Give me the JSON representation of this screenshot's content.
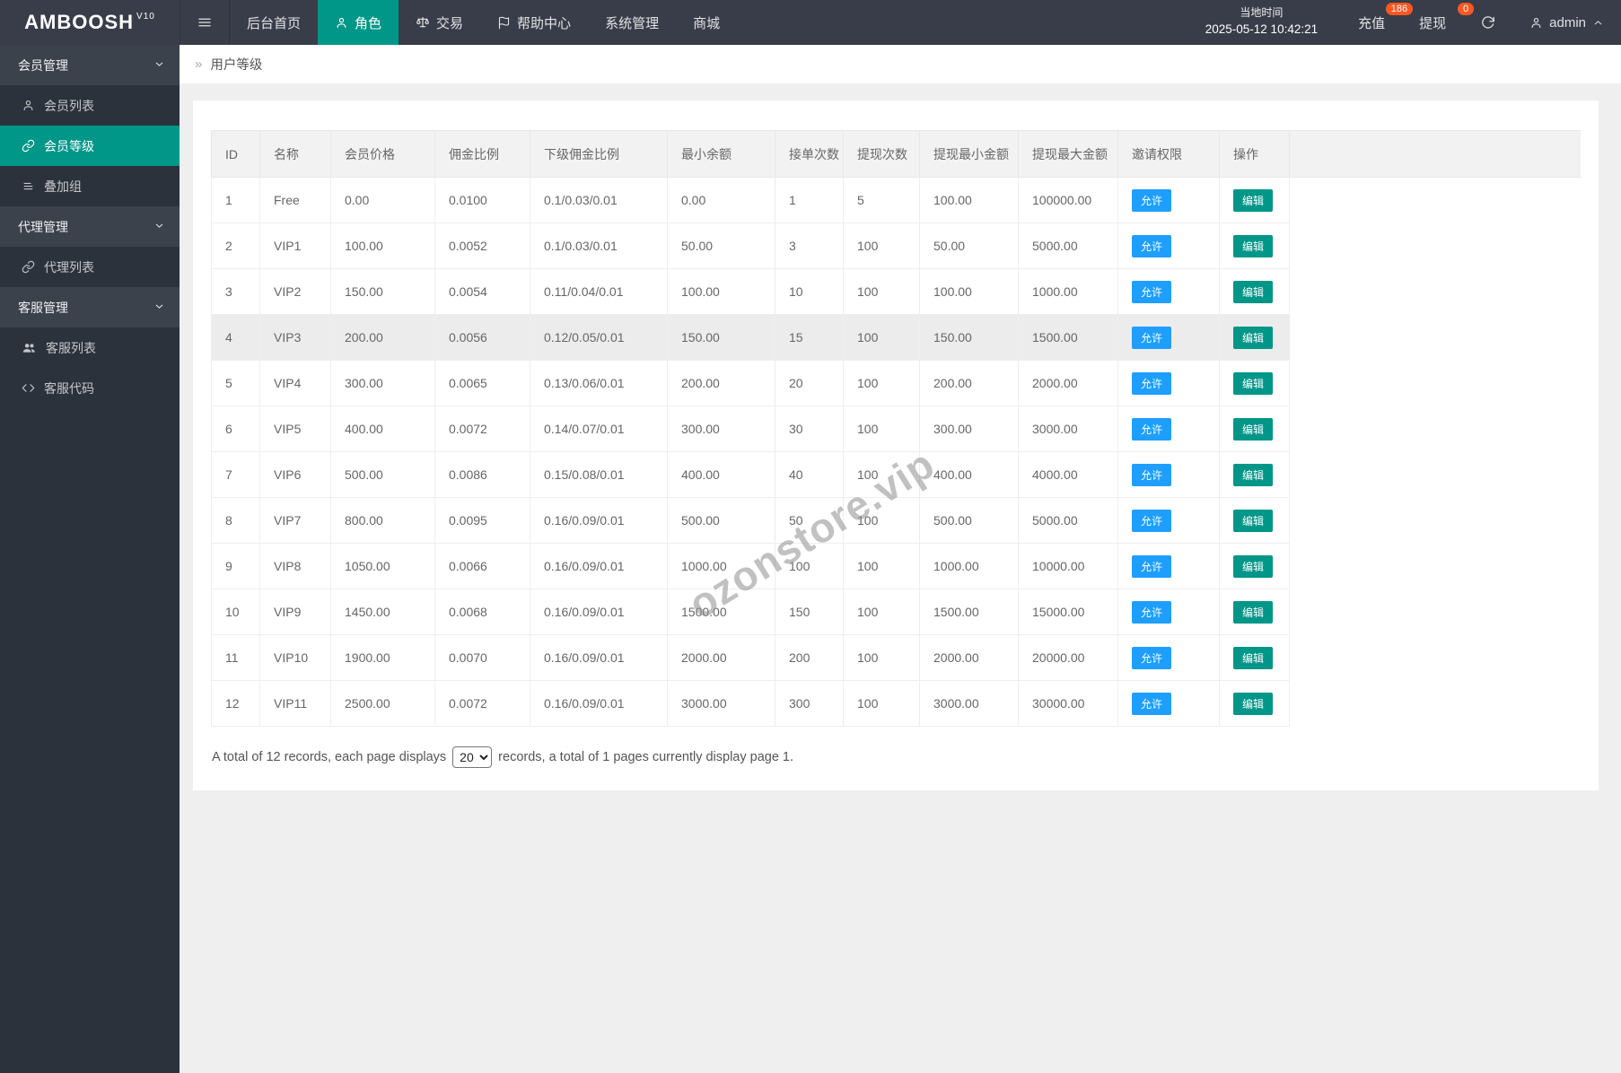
{
  "navbar": {
    "logo": "AMBOOSH",
    "logo_version": "V10",
    "menu": [
      {
        "id": "home",
        "label": "后台首页",
        "icon": "",
        "active": false
      },
      {
        "id": "role",
        "label": "角色",
        "icon": "person",
        "active": true
      },
      {
        "id": "trade",
        "label": "交易",
        "icon": "scale",
        "active": false
      },
      {
        "id": "help",
        "label": "帮助中心",
        "icon": "flag",
        "active": false
      },
      {
        "id": "system",
        "label": "系统管理",
        "icon": "",
        "active": false
      },
      {
        "id": "mall",
        "label": "商城",
        "icon": "",
        "active": false
      }
    ],
    "local_time_label": "当地时间",
    "local_time_value": "2025-05-12 10:42:21",
    "recharge_label": "充值",
    "recharge_badge": "186",
    "withdraw_label": "提现",
    "withdraw_badge": "0",
    "username": "admin"
  },
  "sidebar": {
    "groups": [
      {
        "label": "会员管理",
        "items": [
          {
            "label": "会员列表",
            "icon": "person",
            "active": false
          },
          {
            "label": "会员等级",
            "icon": "link",
            "active": true
          },
          {
            "label": "叠加组",
            "icon": "list",
            "active": false
          }
        ]
      },
      {
        "label": "代理管理",
        "items": [
          {
            "label": "代理列表",
            "icon": "link",
            "active": false
          }
        ]
      },
      {
        "label": "客服管理",
        "items": [
          {
            "label": "客服列表",
            "icon": "users",
            "active": false
          },
          {
            "label": "客服代码",
            "icon": "code",
            "active": false
          }
        ]
      }
    ]
  },
  "breadcrumb": {
    "arrow": "»",
    "title": "用户等级"
  },
  "table": {
    "headers": [
      "ID",
      "名称",
      "会员价格",
      "佣金比例",
      "下级佣金比例",
      "最小余额",
      "接单次数",
      "提现次数",
      "提现最小金额",
      "提现最大金额",
      "邀请权限",
      "操作"
    ],
    "rows": [
      {
        "cells": [
          "1",
          "Free",
          "0.00",
          "0.0100",
          "0.1/0.03/0.01",
          "0.00",
          "1",
          "5",
          "100.00",
          "100000.00"
        ],
        "invite": "允许",
        "action": "编辑",
        "highlight": false
      },
      {
        "cells": [
          "2",
          "VIP1",
          "100.00",
          "0.0052",
          "0.1/0.03/0.01",
          "50.00",
          "3",
          "100",
          "50.00",
          "5000.00"
        ],
        "invite": "允许",
        "action": "编辑",
        "highlight": false
      },
      {
        "cells": [
          "3",
          "VIP2",
          "150.00",
          "0.0054",
          "0.11/0.04/0.01",
          "100.00",
          "10",
          "100",
          "100.00",
          "1000.00"
        ],
        "invite": "允许",
        "action": "编辑",
        "highlight": false
      },
      {
        "cells": [
          "4",
          "VIP3",
          "200.00",
          "0.0056",
          "0.12/0.05/0.01",
          "150.00",
          "15",
          "100",
          "150.00",
          "1500.00"
        ],
        "invite": "允许",
        "action": "编辑",
        "highlight": true
      },
      {
        "cells": [
          "5",
          "VIP4",
          "300.00",
          "0.0065",
          "0.13/0.06/0.01",
          "200.00",
          "20",
          "100",
          "200.00",
          "2000.00"
        ],
        "invite": "允许",
        "action": "编辑",
        "highlight": false
      },
      {
        "cells": [
          "6",
          "VIP5",
          "400.00",
          "0.0072",
          "0.14/0.07/0.01",
          "300.00",
          "30",
          "100",
          "300.00",
          "3000.00"
        ],
        "invite": "允许",
        "action": "编辑",
        "highlight": false
      },
      {
        "cells": [
          "7",
          "VIP6",
          "500.00",
          "0.0086",
          "0.15/0.08/0.01",
          "400.00",
          "40",
          "100",
          "400.00",
          "4000.00"
        ],
        "invite": "允许",
        "action": "编辑",
        "highlight": false
      },
      {
        "cells": [
          "8",
          "VIP7",
          "800.00",
          "0.0095",
          "0.16/0.09/0.01",
          "500.00",
          "50",
          "100",
          "500.00",
          "5000.00"
        ],
        "invite": "允许",
        "action": "编辑",
        "highlight": false
      },
      {
        "cells": [
          "9",
          "VIP8",
          "1050.00",
          "0.0066",
          "0.16/0.09/0.01",
          "1000.00",
          "100",
          "100",
          "1000.00",
          "10000.00"
        ],
        "invite": "允许",
        "action": "编辑",
        "highlight": false
      },
      {
        "cells": [
          "10",
          "VIP9",
          "1450.00",
          "0.0068",
          "0.16/0.09/0.01",
          "1500.00",
          "150",
          "100",
          "1500.00",
          "15000.00"
        ],
        "invite": "允许",
        "action": "编辑",
        "highlight": false
      },
      {
        "cells": [
          "11",
          "VIP10",
          "1900.00",
          "0.0070",
          "0.16/0.09/0.01",
          "2000.00",
          "200",
          "100",
          "2000.00",
          "20000.00"
        ],
        "invite": "允许",
        "action": "编辑",
        "highlight": false
      },
      {
        "cells": [
          "12",
          "VIP11",
          "2500.00",
          "0.0072",
          "0.16/0.09/0.01",
          "3000.00",
          "300",
          "100",
          "3000.00",
          "30000.00"
        ],
        "invite": "允许",
        "action": "编辑",
        "highlight": false
      }
    ]
  },
  "pagination": {
    "text_before": "A total of 12 records, each page displays",
    "page_size": "20",
    "text_after": "records, a total of 1 pages currently display page 1."
  },
  "watermark": "ozonstore.vip",
  "colors": {
    "accent_teal": "#009688",
    "navbar_bg": "#393d49",
    "sidebar_bg": "#2c323c",
    "badge_red": "#ff5722",
    "allow_blue": "#1e9fff"
  }
}
